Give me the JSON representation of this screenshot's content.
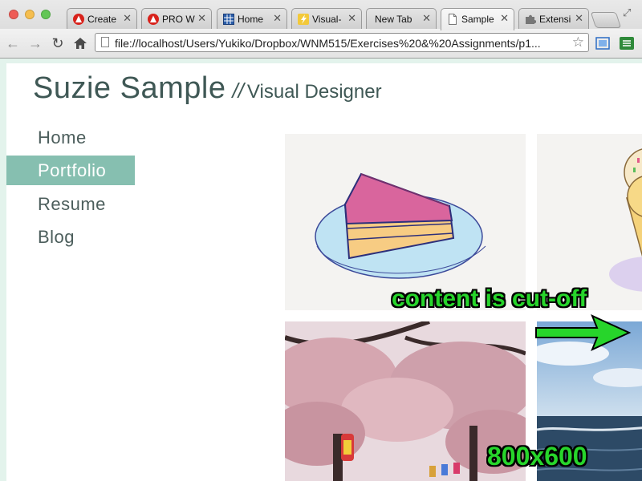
{
  "browser": {
    "tabs": [
      {
        "title": "Create",
        "icon": "red-warning-icon"
      },
      {
        "title": "PRO WN",
        "icon": "red-warning-icon"
      },
      {
        "title": "Home",
        "icon": "blue-grid-icon"
      },
      {
        "title": "Visual-",
        "icon": "yellow-lightning-icon"
      },
      {
        "title": "New Tab",
        "icon": ""
      },
      {
        "title": "Sample",
        "icon": "page-icon",
        "active": true
      },
      {
        "title": "Extensi",
        "icon": "puzzle-icon"
      }
    ],
    "url": "file://localhost/Users/Yukiko/Dropbox/WNM515/Exercises%20&%20Assignments/p1..."
  },
  "site": {
    "name": "Suzie Sample",
    "separator": "//",
    "role": "Visual Designer"
  },
  "nav": {
    "items": [
      {
        "label": "Home"
      },
      {
        "label": "Portfolio",
        "active": true
      },
      {
        "label": "Resume"
      },
      {
        "label": "Blog"
      }
    ]
  },
  "portfolio": {
    "thumbnails": [
      "cake-slice-illustration",
      "ice-cream-illustration",
      "cherry-blossom-photo",
      "ocean-photo"
    ]
  },
  "annotations": {
    "cutoff": "content is cut-off",
    "size": "800x600",
    "color": "#27d52b"
  },
  "colors": {
    "accent": "#86bfb0",
    "title": "#3f5855",
    "page_bg": "#e3f3ec"
  }
}
